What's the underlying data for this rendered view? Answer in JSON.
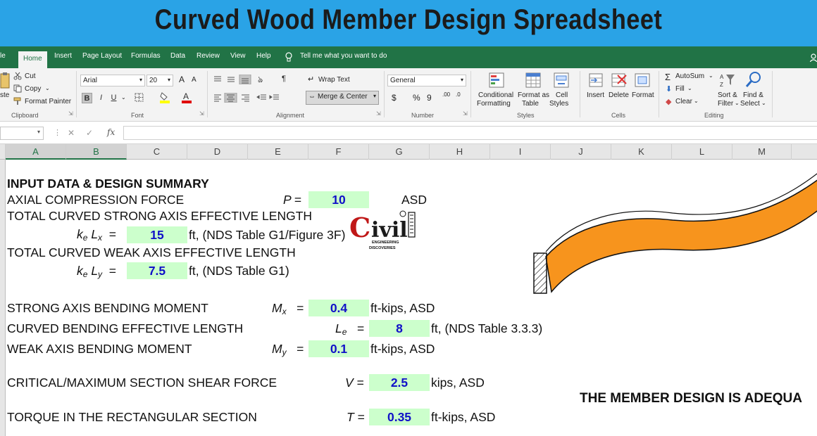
{
  "banner": {
    "title": "Curved Wood Member Design Spreadsheet"
  },
  "ribbon_tabs": [
    "le",
    "Home",
    "Insert",
    "Page Layout",
    "Formulas",
    "Data",
    "Review",
    "View",
    "Help",
    "Tell me what you want to do"
  ],
  "clipboard": {
    "paste": "ste",
    "cut": "Cut",
    "copy": "Copy",
    "format_painter": "Format Painter",
    "label": "Clipboard"
  },
  "font": {
    "name": "Arial",
    "size": "20",
    "grow": "A",
    "shrink": "A",
    "bold": "B",
    "italic": "I",
    "underline": "U",
    "label": "Font"
  },
  "alignment": {
    "wrap_text": "Wrap Text",
    "merge_center": "Merge & Center",
    "label": "Alignment"
  },
  "number": {
    "format": "General",
    "currency": "$",
    "percent": "%",
    "comma": "9",
    "inc_decimal": ".00",
    "dec_decimal": ".0",
    "label": "Number"
  },
  "styles": {
    "conditional": "Conditional",
    "conditional2": "Formatting",
    "format_as": "Format as",
    "format_as2": "Table",
    "cell": "Cell",
    "cell2": "Styles",
    "label": "Styles"
  },
  "cells": {
    "insert": "Insert",
    "delete": "Delete",
    "format": "Format",
    "label": "Cells"
  },
  "editing": {
    "autosum": "AutoSum",
    "fill": "Fill",
    "clear": "Clear",
    "sort": "Sort &",
    "sort2": "Filter",
    "find": "Find &",
    "find2": "Select",
    "label": "Editing"
  },
  "formula_bar": {
    "fx": "fx",
    "cancel": "✕",
    "enter": "✓"
  },
  "columns": [
    "A",
    "B",
    "C",
    "D",
    "E",
    "F",
    "G",
    "H",
    "I",
    "J",
    "K",
    "L",
    "M"
  ],
  "sheet": {
    "heading": "INPUT DATA & DESIGN SUMMARY",
    "axial": {
      "label": "AXIAL COMPRESSION FORCE",
      "symbol": "P",
      "eq": "=",
      "value": "10",
      "unit": "ASD"
    },
    "strong_len": {
      "label": "TOTAL CURVED STRONG AXIS EFFECTIVE LENGTH"
    },
    "kelx": {
      "k": "k",
      "e": "e",
      "l": "L",
      "x": "x",
      "eq": "=",
      "value": "15",
      "unit": "ft, (NDS Table G1/Figure 3F)"
    },
    "weak_len": {
      "label": "TOTAL CURVED WEAK AXIS EFFECTIVE LENGTH"
    },
    "kely": {
      "k": "k",
      "e": "e",
      "l": "L",
      "y": "y",
      "eq": "=",
      "value": "7.5",
      "unit": "ft, (NDS Table G1)"
    },
    "mx": {
      "label": "STRONG AXIS BENDING MOMENT",
      "symbol": "M",
      "sub": "x",
      "eq": "=",
      "value": "0.4",
      "unit": "ft-kips, ASD"
    },
    "le": {
      "label": "CURVED BENDING EFFECTIVE LENGTH",
      "symbol": "L",
      "sub": "e",
      "eq": "=",
      "value": "8",
      "unit": "ft, (NDS Table 3.3.3)"
    },
    "my": {
      "label": "WEAK AXIS BENDING MOMENT",
      "symbol": "M",
      "sub": "y",
      "eq": "=",
      "value": "0.1",
      "unit": "ft-kips, ASD"
    },
    "v": {
      "label": "CRITICAL/MAXIMUM SECTION SHEAR FORCE",
      "symbol": "V",
      "eq": "=",
      "value": "2.5",
      "unit": "kips, ASD"
    },
    "t": {
      "label": "TORQUE IN THE RECTANGULAR SECTION",
      "symbol": "T",
      "eq": "=",
      "value": "0.35",
      "unit": "ft-kips, ASD"
    },
    "verdict": "THE MEMBER DESIGN IS ADEQUA"
  },
  "logo": {
    "word": "Civil",
    "line1": "ENGINEERING",
    "line2": "DISCOVERIES"
  },
  "colors": {
    "banner": "#2aa3e6",
    "excel_green": "#217346",
    "input_fill": "#ccffcc",
    "input_text": "#1010c8",
    "beam": "#f7941d"
  }
}
